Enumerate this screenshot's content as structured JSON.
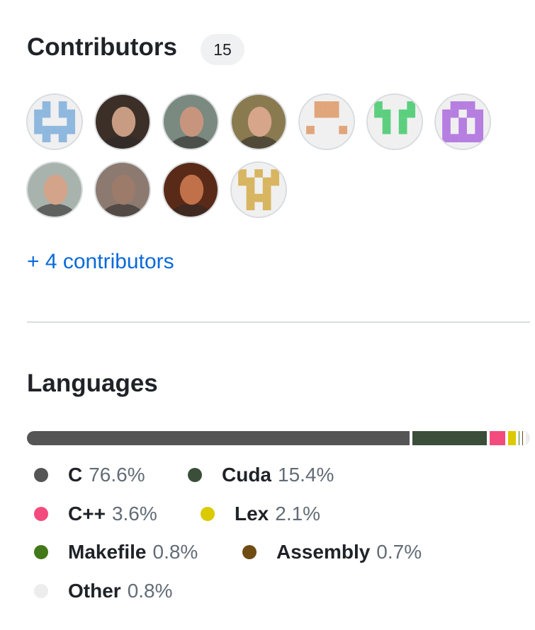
{
  "contributors": {
    "title": "Contributors",
    "count": "15",
    "more_link": "+ 4 contributors",
    "avatars": [
      {
        "kind": "identicon",
        "color": "#8fb8df",
        "pattern": "w"
      },
      {
        "kind": "photo",
        "tone": "#3c2f28",
        "skin": "#c79c82"
      },
      {
        "kind": "photo",
        "tone": "#7a8a80",
        "skin": "#c7957e"
      },
      {
        "kind": "photo",
        "tone": "#8a7a50",
        "skin": "#d6a58a"
      },
      {
        "kind": "identicon",
        "color": "#e0a57a",
        "pattern": "arch"
      },
      {
        "kind": "identicon",
        "color": "#5ccf7f",
        "pattern": "fork"
      },
      {
        "kind": "identicon",
        "color": "#b57ee0",
        "pattern": "box"
      },
      {
        "kind": "photo",
        "tone": "#a9b3ad",
        "skin": "#d3a489"
      },
      {
        "kind": "photo",
        "tone": "#8c7a70",
        "skin": "#9c7b6a"
      },
      {
        "kind": "photo",
        "tone": "#5a2a18",
        "skin": "#c0714a"
      },
      {
        "kind": "identicon",
        "color": "#d8b560",
        "pattern": "check"
      }
    ]
  },
  "languages": {
    "title": "Languages",
    "items": [
      {
        "name": "C",
        "percent": "76.6%",
        "value": 76.6,
        "color": "#555555"
      },
      {
        "name": "Cuda",
        "percent": "15.4%",
        "value": 15.4,
        "color": "#3a4e3a"
      },
      {
        "name": "C++",
        "percent": "3.6%",
        "value": 3.6,
        "color": "#f34b7d"
      },
      {
        "name": "Lex",
        "percent": "2.1%",
        "value": 2.1,
        "color": "#dbca00"
      },
      {
        "name": "Makefile",
        "percent": "0.8%",
        "value": 0.8,
        "color": "#427819"
      },
      {
        "name": "Assembly",
        "percent": "0.7%",
        "value": 0.7,
        "color": "#6e4c13"
      },
      {
        "name": "Other",
        "percent": "0.8%",
        "value": 0.8,
        "color": "#ededed"
      }
    ]
  }
}
